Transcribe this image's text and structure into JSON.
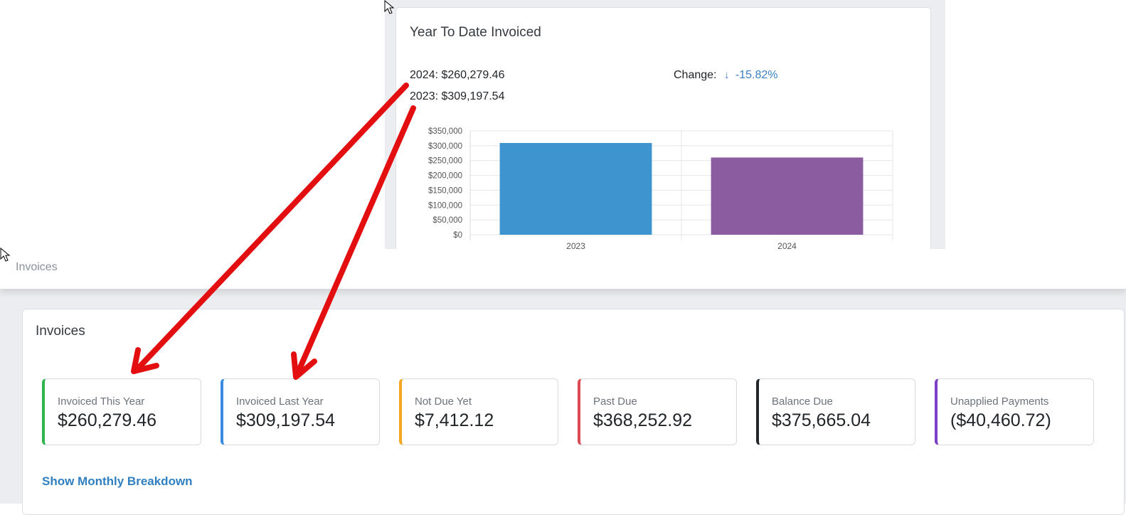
{
  "chart_card": {
    "title": "Year To Date Invoiced",
    "line_2024": "2024: $260,279.46",
    "line_2023": "2023: $309,197.54",
    "change_label": "Change:",
    "change_value": "-15.82%"
  },
  "chart_data": {
    "type": "bar",
    "categories": [
      "2023",
      "2024"
    ],
    "values": [
      309197.54,
      260279.46
    ],
    "colors": [
      "#3d94cf",
      "#8b5ca0"
    ],
    "ylim": [
      0,
      350000
    ],
    "yticks": [
      "$0",
      "$50,000",
      "$100,000",
      "$150,000",
      "$200,000",
      "$250,000",
      "$300,000",
      "$350,000"
    ],
    "grid": true,
    "title": "",
    "xlabel": "",
    "ylabel": ""
  },
  "breadcrumb": {
    "label": "Invoices"
  },
  "invoices_card": {
    "title": "Invoices",
    "stats": [
      {
        "label": "Invoiced This Year",
        "value": "$260,279.46",
        "color": "#2fb34e"
      },
      {
        "label": "Invoiced Last Year",
        "value": "$309,197.54",
        "color": "#3a8be0"
      },
      {
        "label": "Not Due Yet",
        "value": "$7,412.12",
        "color": "#f5a623"
      },
      {
        "label": "Past Due",
        "value": "$368,252.92",
        "color": "#dd4b52"
      },
      {
        "label": "Balance Due",
        "value": "$375,665.04",
        "color": "#23262a"
      },
      {
        "label": "Unapplied Payments",
        "value": "($40,460.72)",
        "color": "#7a3fc4"
      }
    ],
    "monthly_link": "Show Monthly Breakdown"
  },
  "annotation": {
    "arrow_color": "#e30e10"
  }
}
